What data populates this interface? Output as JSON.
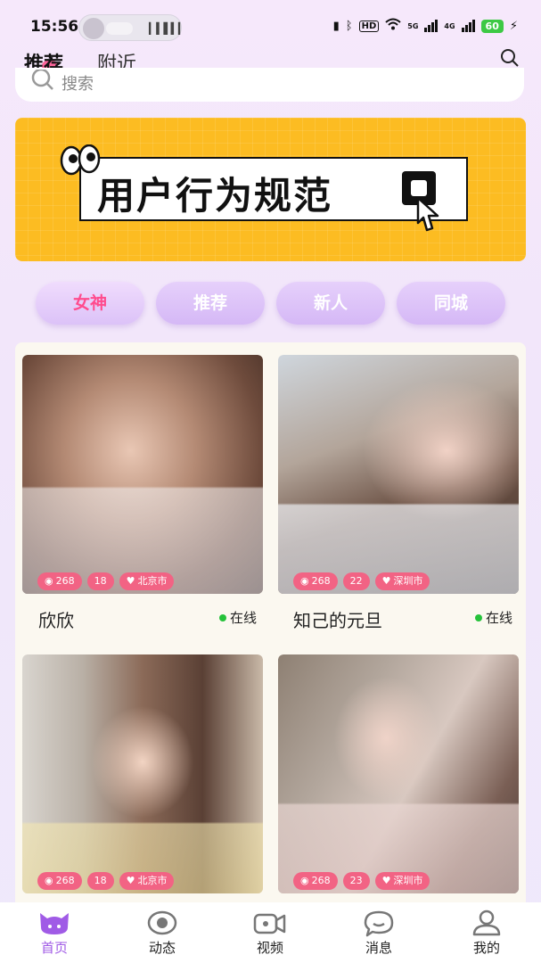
{
  "status_bar": {
    "time": "15:56",
    "battery": "60",
    "network_5g": "5G",
    "network_4g": "4G",
    "hd_label": "HD"
  },
  "top_nav": {
    "tabs": [
      {
        "label": "推荐",
        "active": true
      },
      {
        "label": "附近",
        "active": false
      }
    ]
  },
  "search": {
    "placeholder": "搜索"
  },
  "banner": {
    "title": "用户行为规范",
    "bg_color": "#fcbc22"
  },
  "categories": [
    {
      "label": "女神",
      "active": true
    },
    {
      "label": "推荐",
      "active": false
    },
    {
      "label": "新人",
      "active": false
    },
    {
      "label": "同城",
      "active": false
    }
  ],
  "profiles": [
    {
      "name": "欣欣",
      "views": "268",
      "age": "18",
      "city": "北京市",
      "status": "在线"
    },
    {
      "name": "知己的元旦",
      "views": "268",
      "age": "22",
      "city": "深圳市",
      "status": "在线"
    },
    {
      "name": "",
      "views": "268",
      "age": "18",
      "city": "北京市",
      "status": ""
    },
    {
      "name": "",
      "views": "268",
      "age": "23",
      "city": "深圳市",
      "status": ""
    }
  ],
  "bottom_nav": [
    {
      "label": "首页",
      "icon": "home-icon",
      "active": true
    },
    {
      "label": "动态",
      "icon": "eye-icon",
      "active": false
    },
    {
      "label": "视频",
      "icon": "video-icon",
      "active": false
    },
    {
      "label": "消息",
      "icon": "message-icon",
      "active": false
    },
    {
      "label": "我的",
      "icon": "profile-icon",
      "active": false
    }
  ],
  "colors": {
    "accent_pink": "#ff4c8e",
    "tag_pink": "#f26384",
    "pill_purple": "#d5b8f6",
    "nav_active": "#a05be6",
    "online_green": "#25c23a"
  }
}
